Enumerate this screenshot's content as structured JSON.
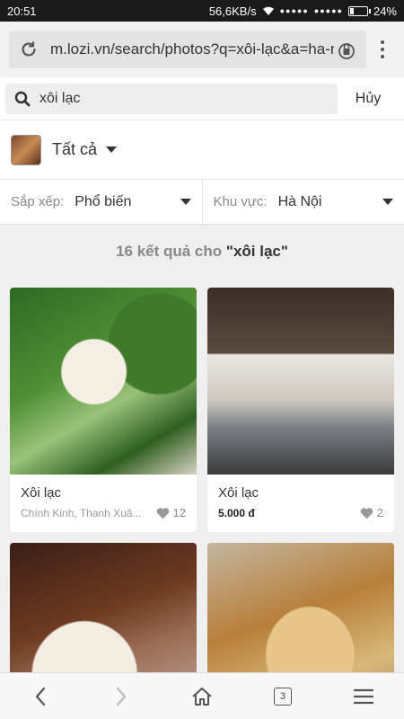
{
  "status_bar": {
    "time": "20:51",
    "network_speed": "56,6KB/s",
    "signal_1": "●●●●●",
    "signal_2": "●●●●●",
    "battery_label": "24%",
    "battery_level": 0.24
  },
  "browser": {
    "url": "m.lozi.vn/search/photos?q=xôi-lạc&a=ha-noi",
    "reload_icon": "reload-icon",
    "lock_icon": "lock-icon",
    "menu_icon": "more-vertical-icon"
  },
  "search": {
    "value": "xôi lạc",
    "cancel_label": "Hủy",
    "icon": "search-icon"
  },
  "category": {
    "label": "Tất cả"
  },
  "filters": {
    "sort_label": "Sắp xếp:",
    "sort_value": "Phổ biến",
    "area_label": "Khu vực:",
    "area_value": "Hà Nội"
  },
  "results": {
    "count_text": "16 kết quả cho ",
    "query_text": "\"xôi lạc\""
  },
  "cards": [
    {
      "name": "Xôi lạc",
      "sub": "Chính Kinh, Thanh Xuâ...",
      "likes": "12"
    },
    {
      "name": "Xôi lạc",
      "price": "5.000 đ",
      "likes": "2"
    }
  ],
  "bottom_nav": {
    "tabs_count": "3"
  },
  "colors": {
    "status_bar": "#1a1a1a",
    "browser_bar": "#f2f2f2",
    "background": "#efefef"
  }
}
